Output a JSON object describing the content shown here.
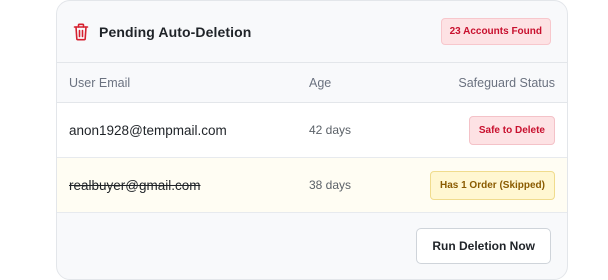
{
  "header": {
    "title": "Pending Auto-Deletion",
    "count_badge": "23 Accounts Found",
    "icon": "trash-icon"
  },
  "table": {
    "columns": [
      "User Email",
      "Age",
      "Safeguard Status"
    ],
    "rows": [
      {
        "email": "anon1928@tempmail.com",
        "age": "42 days",
        "status": "Safe to Delete",
        "status_type": "danger",
        "struck": false
      },
      {
        "email": "realbuyer@gmail.com",
        "age": "38 days",
        "status": "Has 1 Order (Skipped)",
        "status_type": "warning",
        "struck": true
      }
    ]
  },
  "footer": {
    "run_label": "Run Deletion Now"
  },
  "colors": {
    "danger": "#c8102e",
    "warning_text": "#8a5b00",
    "warning_bg": "#fff7d1"
  }
}
